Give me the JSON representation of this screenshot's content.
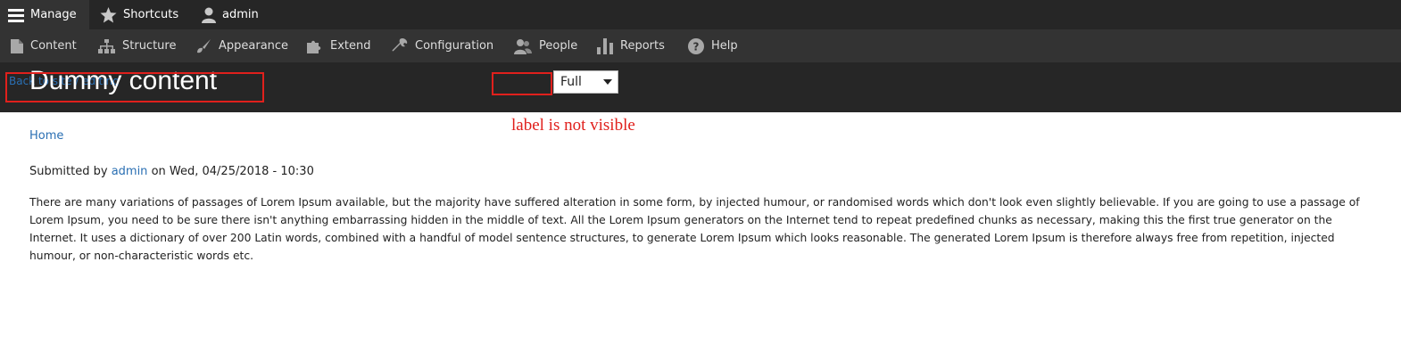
{
  "toolbar": {
    "manage": "Manage",
    "shortcuts": "Shortcuts",
    "user": "admin"
  },
  "tray": {
    "items": [
      {
        "label": "Content",
        "icon": "file-icon"
      },
      {
        "label": "Structure",
        "icon": "sitemap-icon"
      },
      {
        "label": "Appearance",
        "icon": "paintbrush-icon"
      },
      {
        "label": "Extend",
        "icon": "puzzle-icon"
      },
      {
        "label": "Configuration",
        "icon": "wrench-icon"
      },
      {
        "label": "People",
        "icon": "people-icon"
      },
      {
        "label": "Reports",
        "icon": "bars-icon"
      },
      {
        "label": "Help",
        "icon": "help-icon"
      }
    ]
  },
  "header": {
    "back_link": "Back to site / editing",
    "title": "Dummy content",
    "view_mode_selected": "Full"
  },
  "annotation": "label is not visible",
  "content": {
    "breadcrumb_home": "Home",
    "submitted_prefix": "Submitted by",
    "author": "admin",
    "submitted_suffix": "on Wed, 04/25/2018 - 10:30",
    "body": "There are many variations of passages of Lorem Ipsum available, but the majority have suffered alteration in some form, by injected humour, or randomised words which don't look even slightly believable. If you are going to use a passage of Lorem Ipsum, you need to be sure there isn't anything embarrassing hidden in the middle of text. All the Lorem Ipsum generators on the Internet tend to repeat predefined chunks as necessary, making this the first true generator on the Internet. It uses a dictionary of over 200 Latin words, combined with a handful of model sentence structures, to generate Lorem Ipsum which looks reasonable. The generated Lorem Ipsum is therefore always free from repetition, injected humour, or non-characteristic words etc."
  },
  "colors": {
    "annotation_red": "#e0201c",
    "link_blue": "#2a6fb3",
    "toolbar_dark": "#262626"
  }
}
